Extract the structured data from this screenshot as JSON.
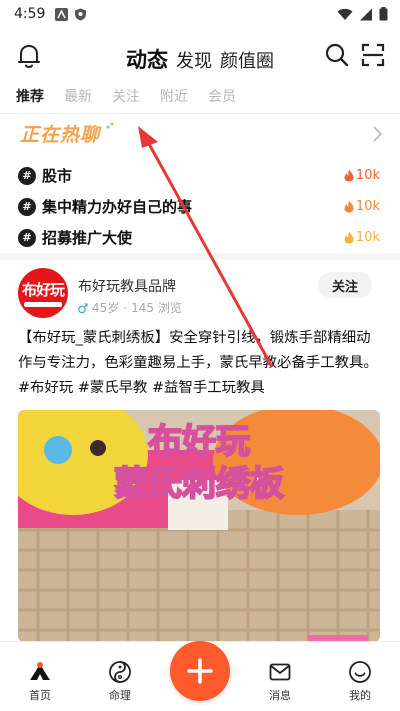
{
  "status_bar": {
    "time": "4:59"
  },
  "header": {
    "tabs": [
      {
        "label": "动态",
        "active": true
      },
      {
        "label": "发现",
        "active": false
      },
      {
        "label": "颜值圈",
        "active": false
      }
    ]
  },
  "sub_tabs": [
    {
      "label": "推荐",
      "active": true
    },
    {
      "label": "最新",
      "active": false
    },
    {
      "label": "关注",
      "active": false
    },
    {
      "label": "附近",
      "active": false
    },
    {
      "label": "会员",
      "active": false
    }
  ],
  "hot": {
    "title": "正在热聊",
    "items": [
      {
        "hash": "#",
        "label": "股市",
        "count": "10k",
        "color": "#f0613a"
      },
      {
        "hash": "#",
        "label": "集中精力办好自己的事",
        "count": "10k",
        "color": "#f0873a"
      },
      {
        "hash": "#",
        "label": "招募推广大使",
        "count": "10k",
        "color": "#f3b33a"
      }
    ]
  },
  "post": {
    "avatar_text": "布好玩",
    "author": "布好玩教具品牌",
    "age": "45岁",
    "separator": "·",
    "views": "145 浏览",
    "follow_label": "关注",
    "text": "【布好玩_蒙氏刺绣板】安全穿针引线，锻炼手部精细动作与专注力，色彩童趣易上手，蒙氏早教必备手工教具。#布好玩 #蒙氏早教 #益智手工玩教具",
    "image_title_1": "布好玩",
    "image_title_2": "蒙氏刺绣板"
  },
  "bottom_nav": {
    "items": [
      {
        "label": "首页"
      },
      {
        "label": "命理"
      },
      {
        "label": "消息"
      },
      {
        "label": "我的"
      }
    ]
  },
  "colors": {
    "accent": "#ff5a2c",
    "hot_title": "#f4a24c",
    "arrow": "#e53935",
    "avatar_bg": "#e4161c"
  }
}
